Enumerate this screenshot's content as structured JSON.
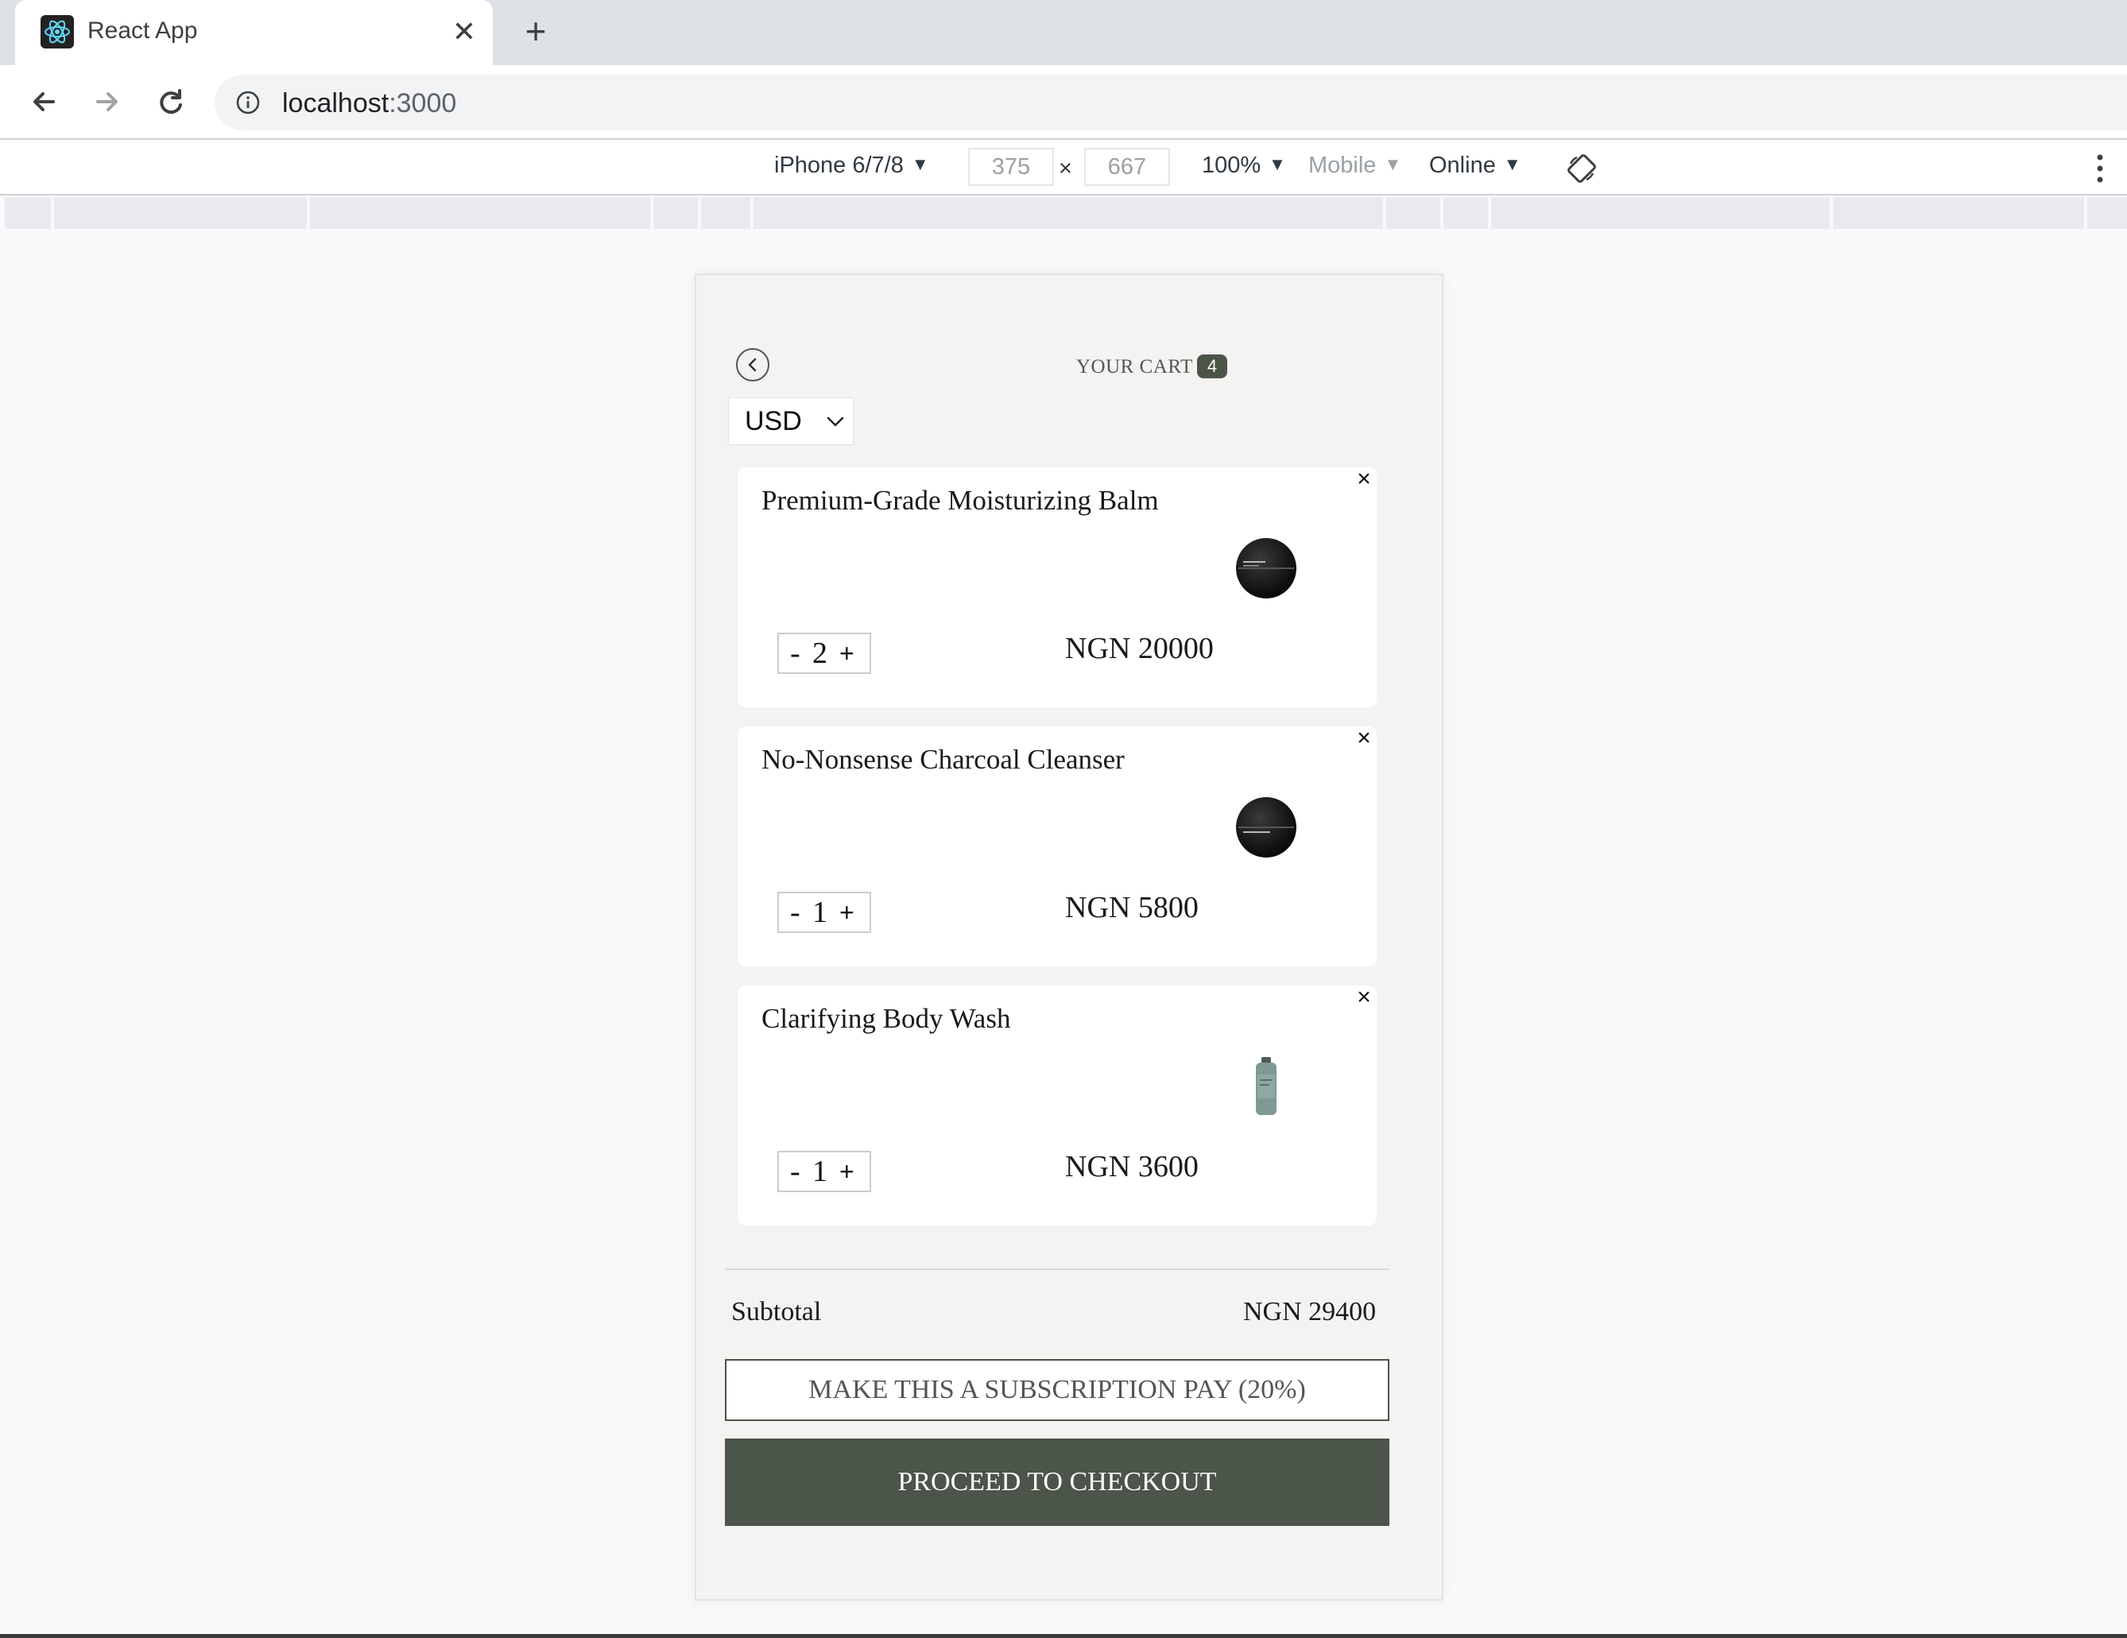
{
  "browser": {
    "tab_title": "React App",
    "url_host": "localhost",
    "url_port": ":3000"
  },
  "devtools": {
    "device": "iPhone 6/7/8",
    "width": "375",
    "times": "×",
    "height": "667",
    "zoom": "100%",
    "mode": "Mobile",
    "network": "Online"
  },
  "cart": {
    "title": "YOUR CART",
    "count": "4",
    "currency": "USD",
    "items": [
      {
        "name": "Premium-Grade Moisturizing Balm",
        "qty": "2",
        "price": "NGN 20000",
        "image": "jar-black"
      },
      {
        "name": "No-Nonsense Charcoal Cleanser",
        "qty": "1",
        "price": "NGN 5800",
        "image": "jar-black"
      },
      {
        "name": "Clarifying Body Wash",
        "qty": "1",
        "price": "NGN 3600",
        "image": "bottle-teal"
      }
    ],
    "subtotal_label": "Subtotal",
    "subtotal_value": "NGN 29400",
    "subscription_label": "MAKE THIS A SUBSCRIPTION PAY (20%)",
    "checkout_label": "PROCEED TO CHECKOUT"
  },
  "colors": {
    "accent": "#4b5549",
    "background": "#f3f3f1"
  }
}
